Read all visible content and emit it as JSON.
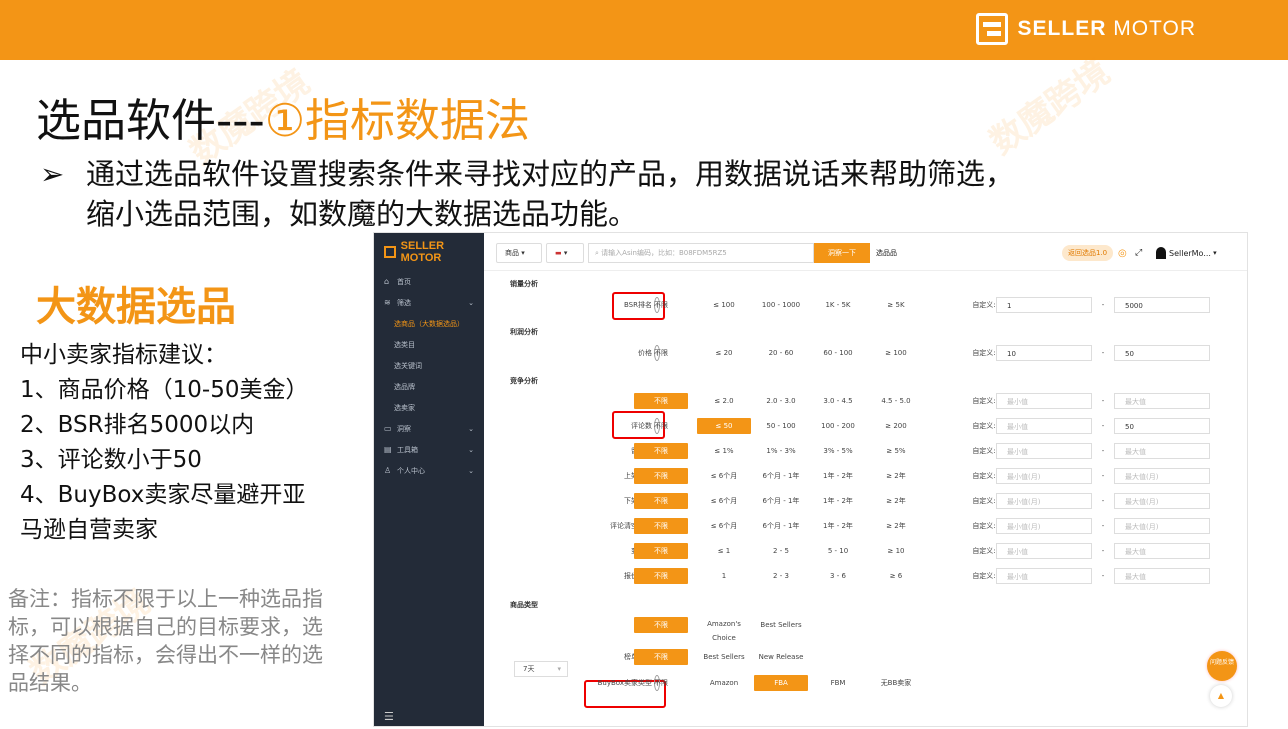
{
  "brand": {
    "bold": "SELLER",
    "light": "MOTOR"
  },
  "title": {
    "main": "选品软件---",
    "accent": "①指标数据法"
  },
  "bullet": {
    "arrow": "➢",
    "line1": "通过选品软件设置搜索条件来寻找对应的产品，用数据说话来帮助筛选，",
    "line2": "缩小选品范围，如数魔的大数据选品功能。"
  },
  "left_heading": "大数据选品",
  "advice": [
    "中小卖家指标建议：",
    "1、商品价格（10-50美金）",
    "2、BSR排名5000以内",
    "3、评论数小于50",
    "4、BuyBox卖家尽量避开亚",
    "马逊自营卖家"
  ],
  "note": "备注：指标不限于以上一种选品指标，可以根据自己的目标要求，选择不同的指标，会得出不一样的选品结果。",
  "watermark": "数魔跨境",
  "app": {
    "logo": "SELLER MOTOR",
    "sidebar": [
      "首页",
      "筛选",
      "选商品（大数据选品）",
      "选类目",
      "选关键词",
      "选品牌",
      "选卖家",
      "洞察",
      "工具箱",
      "个人中心"
    ],
    "sidebar_icons": [
      "⌂",
      "≋",
      "",
      "",
      "",
      "",
      "",
      "▭",
      "▤",
      "♙"
    ],
    "menu_icon": "☰",
    "toolbar": {
      "scope": "商品",
      "flag": "▬",
      "search_placeholder": "请输入Asin编码，比如：B08FDM5RZ5",
      "search_button": "洞察一下",
      "tab": "选品品",
      "back_button": "返回选品1.0",
      "user": "SellerMo..."
    },
    "sections": [
      "销量分析",
      "利润分析",
      "竞争分析",
      "商品类型"
    ],
    "custom_label": "自定义:",
    "rows": [
      {
        "label": "BSR排名",
        "opts": [
          "不限",
          "≤ 100",
          "100 - 1000",
          "1K - 5K",
          "≥ 5K"
        ],
        "active": -1,
        "min": "1",
        "max": "5000"
      },
      {
        "label": "价格",
        "opts": [
          "不限",
          "≤ 20",
          "20 - 60",
          "60 - 100",
          "≥ 100"
        ],
        "active": -1,
        "min": "10",
        "max": "50"
      },
      {
        "label": "评分",
        "opts": [
          "不限",
          "≤ 2.0",
          "2.0 - 3.0",
          "3.0 - 4.5",
          "4.5 - 5.0"
        ],
        "active": 0,
        "min": "最小值",
        "max": "最大值"
      },
      {
        "label": "评论数",
        "opts": [
          "不限",
          "≤ 50",
          "50 - 100",
          "100 - 200",
          "≥ 200"
        ],
        "active": 1,
        "min": "最小值",
        "max": "50"
      },
      {
        "label": "留评率",
        "opts": [
          "不限",
          "≤ 1%",
          "1% - 3%",
          "3% - 5%",
          "≥ 5%"
        ],
        "active": 0,
        "min": "最小值",
        "max": "最大值"
      },
      {
        "label": "上架时间",
        "opts": [
          "不限",
          "≤ 6个月",
          "6个月 - 1年",
          "1年 - 2年",
          "≥ 2年"
        ],
        "active": 0,
        "min": "最小值(月)",
        "max": "最大值(月)"
      },
      {
        "label": "下架时间",
        "opts": [
          "不限",
          "≤ 6个月",
          "6个月 - 1年",
          "1年 - 2年",
          "≥ 2年"
        ],
        "active": 0,
        "min": "最小值(月)",
        "max": "最大值(月)"
      },
      {
        "label": "评论清空时间",
        "opts": [
          "不限",
          "≤ 6个月",
          "6个月 - 1年",
          "1年 - 2年",
          "≥ 2年"
        ],
        "active": 0,
        "min": "最小值(月)",
        "max": "最大值(月)"
      },
      {
        "label": "变体数",
        "opts": [
          "不限",
          "≤ 1",
          "2 - 5",
          "5 - 10",
          "≥ 10"
        ],
        "active": 0,
        "min": "最小值",
        "max": "最大值"
      },
      {
        "label": "报价总数",
        "opts": [
          "不限",
          "1",
          "2 - 3",
          "3 - 6",
          "≥ 6"
        ],
        "active": 0,
        "min": "最小值",
        "max": "最大值"
      },
      {
        "label": "标签",
        "opts": [
          "不限",
          "Amazon's Choice",
          "Best Sellers"
        ],
        "active": 0
      },
      {
        "label": "榜单类型",
        "opts": [
          "不限",
          "Best Sellers",
          "New Release"
        ],
        "active": 0
      },
      {
        "label": "BuyBox卖家类型",
        "opts": [
          "不限",
          "Amazon",
          "FBA",
          "FBM",
          "无BB卖家"
        ],
        "active": 2
      }
    ],
    "range_select": "7天",
    "fab": "问题反馈",
    "up": "▲"
  }
}
